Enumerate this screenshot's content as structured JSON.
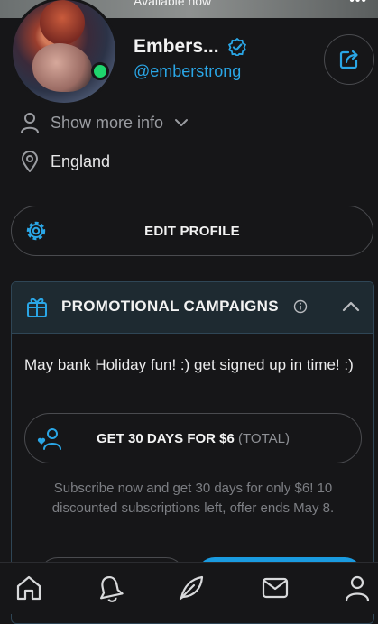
{
  "cover": {
    "status_text": "Available now",
    "more_glyph": "•••"
  },
  "profile": {
    "display_name": "Embers...",
    "username": "@emberstrong",
    "online": true,
    "verified": true
  },
  "info": {
    "show_more_label": "Show more info",
    "location": "England"
  },
  "edit_profile_label": "EDIT PROFILE",
  "promotions": {
    "title": "PROMOTIONAL CAMPAIGNS",
    "message": "May bank Holiday fun! :) get signed up in time! :)",
    "offer_label": "GET 30 DAYS FOR $6",
    "offer_total": "(TOTAL)",
    "offer_note": "Subscribe now and get 30 days for only $6! 10 discounted subscriptions left, offer ends May 8."
  },
  "tabbar": {
    "items": [
      "home-icon",
      "notifications-icon",
      "new-post-icon",
      "messages-icon",
      "profile-icon"
    ]
  },
  "colors": {
    "accent": "#2aa6e6",
    "background": "#161618",
    "online": "#1fd56e",
    "promo_header": "#1e2a31"
  }
}
